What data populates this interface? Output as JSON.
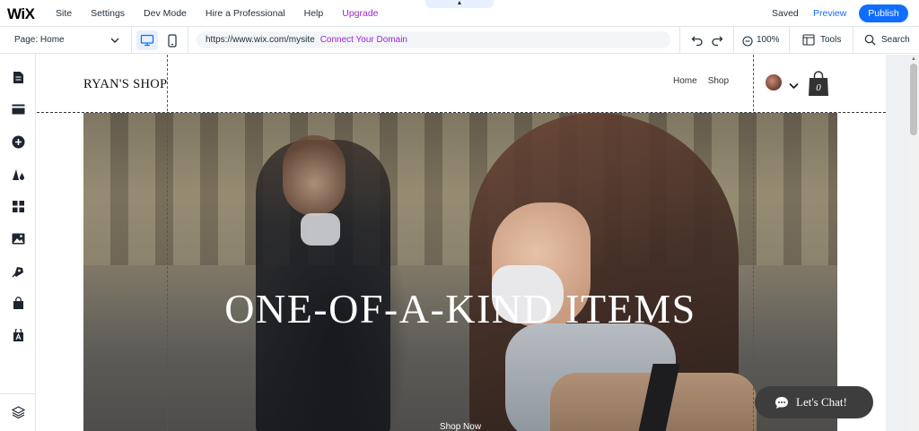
{
  "topbar": {
    "logo": "WiX",
    "menu": [
      "Site",
      "Settings",
      "Dev Mode",
      "Hire a Professional",
      "Help"
    ],
    "upgrade": "Upgrade",
    "collapse_glyph": "▲",
    "saved": "Saved",
    "preview": "Preview",
    "publish": "Publish"
  },
  "secondbar": {
    "page_label": "Page: Home",
    "url": "https://www.wix.com/mysite",
    "connect_domain": "Connect Your Domain",
    "zoom": "100%",
    "tools": "Tools",
    "search": "Search"
  },
  "left_toolbar": {
    "icons": [
      "pages-icon",
      "sections-icon",
      "add-icon",
      "design-icon",
      "apps-icon",
      "media-icon",
      "blog-icon",
      "store-icon",
      "bookings-icon",
      "layers-icon"
    ]
  },
  "site": {
    "title": "RYAN'S SHOP",
    "nav": [
      "Home",
      "Shop"
    ],
    "cart_count": "0",
    "hero_title": "ONE-OF-A-KIND ITEMS",
    "hero_button": "Shop Now",
    "chat_label": "Let's Chat!"
  },
  "colors": {
    "accent": "#116dff",
    "upgrade": "#9a27d5",
    "chat_bg": "#3d3d3d"
  }
}
